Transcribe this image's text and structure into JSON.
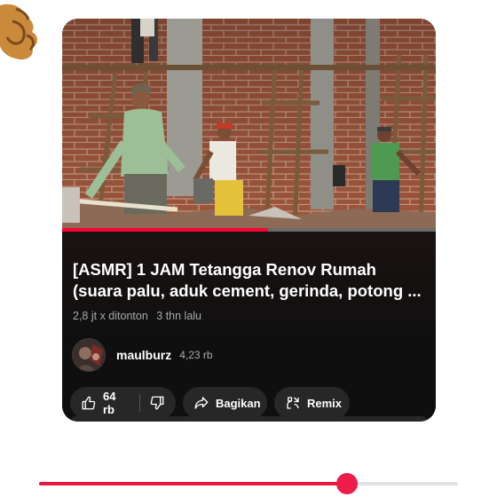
{
  "video": {
    "title": "[ASMR] 1 JAM Tetangga Renov Rumah (suara palu, aduk cement, gerinda, potong ...",
    "views": "2,8 jt x ditonton",
    "age": "3 thn lalu",
    "watch_progress": 0.55
  },
  "channel": {
    "name": "maulburz",
    "subscribers": "4,23 rb"
  },
  "actions": {
    "like_count": "64 rb",
    "share_label": "Bagikan",
    "remix_label": "Remix"
  },
  "player": {
    "seek_progress": 0.735,
    "accent_color": "#ee1c4b"
  },
  "icons": [
    "emoji-hand-icon",
    "thumbs-up-icon",
    "thumbs-down-icon",
    "share-icon",
    "remix-icon"
  ]
}
